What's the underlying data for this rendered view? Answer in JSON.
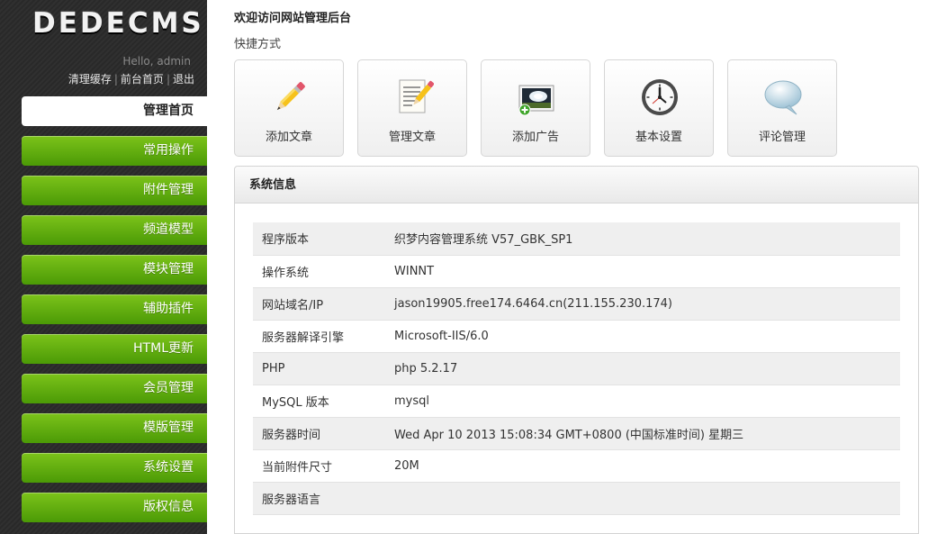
{
  "sidebar": {
    "logo": "DEDECMS",
    "hello": "Hello, admin",
    "links": {
      "clear_cache": "清理缓存",
      "front_home": "前台首页",
      "logout": "退出",
      "separator": "|"
    },
    "menu": [
      {
        "label": "管理首页",
        "active": true
      },
      {
        "label": "常用操作"
      },
      {
        "label": "附件管理"
      },
      {
        "label": "频道模型"
      },
      {
        "label": "模块管理"
      },
      {
        "label": "辅助插件"
      },
      {
        "label": "HTML更新"
      },
      {
        "label": "会员管理"
      },
      {
        "label": "模版管理"
      },
      {
        "label": "系统设置"
      },
      {
        "label": "版权信息"
      }
    ]
  },
  "main": {
    "welcome": "欢迎访问网站管理后台",
    "quick_title": "快捷方式",
    "shortcuts": [
      {
        "label": "添加文章",
        "icon": "pencil-icon"
      },
      {
        "label": "管理文章",
        "icon": "document-edit-icon"
      },
      {
        "label": "添加广告",
        "icon": "picture-add-icon"
      },
      {
        "label": "基本设置",
        "icon": "clock-icon"
      },
      {
        "label": "评论管理",
        "icon": "speech-bubble-icon"
      }
    ],
    "sysinfo": {
      "title": "系统信息",
      "rows": [
        {
          "k": "程序版本",
          "v": "织梦内容管理系统 V57_GBK_SP1"
        },
        {
          "k": "操作系统",
          "v": "WINNT"
        },
        {
          "k": "网站域名/IP",
          "v": "jason19905.free174.6464.cn(211.155.230.174)"
        },
        {
          "k": "服务器解译引擎",
          "v": "Microsoft-IIS/6.0"
        },
        {
          "k": "PHP",
          "v": "php 5.2.17"
        },
        {
          "k": "MySQL 版本",
          "v": "mysql"
        },
        {
          "k": "服务器时间",
          "v": "Wed Apr 10 2013 15:08:34 GMT+0800 (中国标准时间) 星期三"
        },
        {
          "k": "当前附件尺寸",
          "v": "20M"
        },
        {
          "k": "服务器语言",
          "v": ""
        }
      ]
    }
  }
}
